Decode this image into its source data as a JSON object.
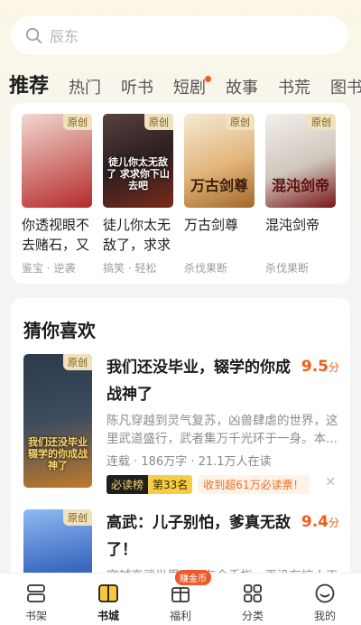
{
  "search": {
    "placeholder": "辰东"
  },
  "tabs": [
    {
      "label": "推荐",
      "active": true
    },
    {
      "label": "热门"
    },
    {
      "label": "听书"
    },
    {
      "label": "短剧",
      "dot": true
    },
    {
      "label": "故事"
    },
    {
      "label": "书荒"
    },
    {
      "label": "图书"
    }
  ],
  "badge_label": "原创",
  "top_books": [
    {
      "title": "你透视眼不去赌石，又",
      "tags": "鉴宝 · 逆袭",
      "cover_text": "",
      "colors": [
        "#f1d8ce",
        "#b42a2a"
      ]
    },
    {
      "title": "徒儿你太无敌了，求求",
      "tags": "搞笑 · 轻松",
      "cover_text": "徒儿你太无敌了 求求你下山去吧",
      "colors": [
        "#3a2d2d",
        "#7a2a1a"
      ]
    },
    {
      "title": "万古剑尊",
      "tags": "杀伐果断",
      "cover_text": "万古剑尊",
      "colors": [
        "#f5ead6",
        "#c88a4a"
      ]
    },
    {
      "title": "混沌剑帝",
      "tags": "杀伐果断",
      "cover_text": "混沌剑帝",
      "colors": [
        "#e7e2dc",
        "#7a1616"
      ]
    }
  ],
  "guess": {
    "title": "猜你喜欢",
    "items": [
      {
        "title": "我们还没毕业，辍学的你成战神了",
        "score": "9.5",
        "score_unit": "分",
        "desc": "陈凡穿越到灵气复苏，凶兽肆虐的世界，这里武道盛行，武者集万千光环于一身。本...",
        "meta": "连载 · 186万字 · 21.1万人在读",
        "rank_a": "必读榜",
        "rank_b": "第33名",
        "rank_c": "收到超61万必读票！",
        "cover_text": "我们还没毕业 辍学的你成战神了",
        "colors": [
          "#2c3a4a",
          "#c07a2a"
        ]
      },
      {
        "title": "高武：儿子别怕，爹真无敌了！",
        "score": "9.4",
        "score_unit": "分",
        "desc": "穿越高武世界，没有金手指，再没有惊人天",
        "cover_text": "",
        "colors": [
          "#1d3c7a",
          "#8fb9f2"
        ]
      }
    ]
  },
  "nav": [
    {
      "label": "书架",
      "icon": "bookshelf-icon"
    },
    {
      "label": "书城",
      "icon": "bookstore-icon",
      "active": true
    },
    {
      "label": "福利",
      "icon": "welfare-icon",
      "pill": "赚金币"
    },
    {
      "label": "分类",
      "icon": "category-icon"
    },
    {
      "label": "我的",
      "icon": "profile-icon"
    }
  ],
  "colors": {
    "accent": "#f6c83a",
    "score": "#f25c18",
    "dot": "#ff5722"
  }
}
